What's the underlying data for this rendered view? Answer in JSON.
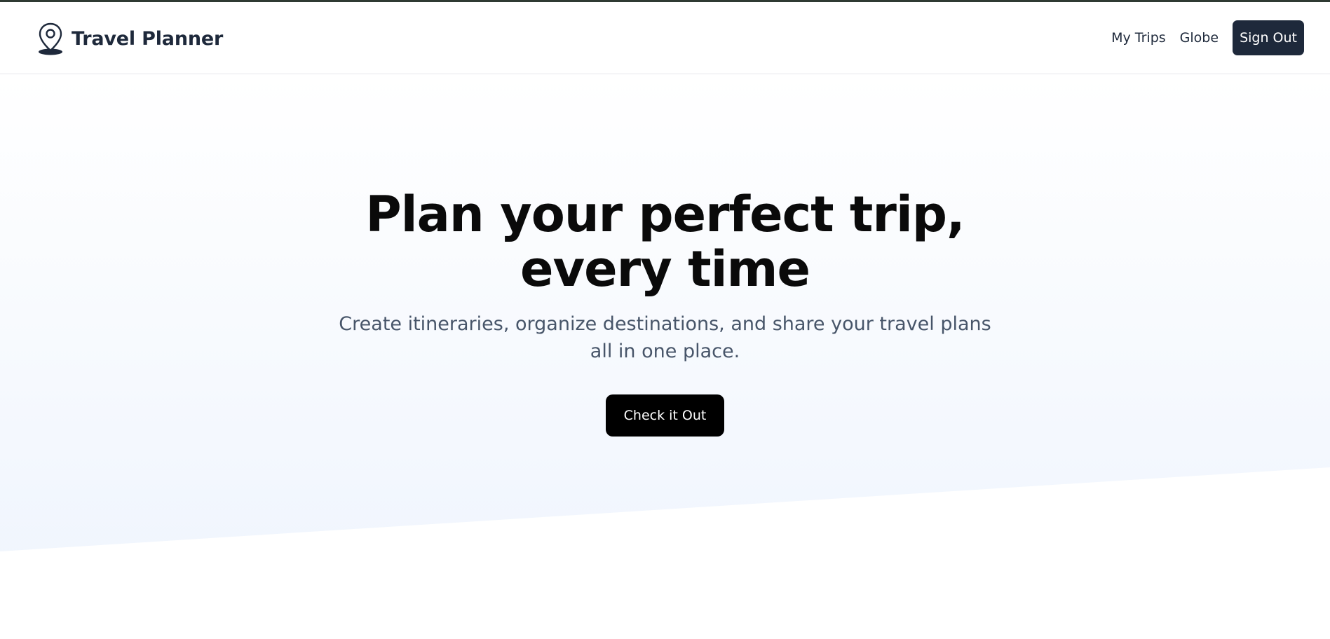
{
  "brand": {
    "icon": "map-pin-icon",
    "title": "Travel Planner"
  },
  "nav": {
    "links": [
      "My Trips",
      "Globe"
    ],
    "sign_out": "Sign Out"
  },
  "hero": {
    "title_line1": "Plan your perfect trip,",
    "title_line2": "every time",
    "subtitle": "Create itineraries, organize destinations, and share your travel plans all in one place.",
    "cta": "Check it Out"
  },
  "colors": {
    "nav_text": "#1e293b",
    "sign_out_bg": "#1e293b",
    "cta_bg": "#000000",
    "hero_gradient_top": "#ffffff",
    "hero_gradient_bottom": "#eef4fd",
    "subtitle": "#475569"
  }
}
